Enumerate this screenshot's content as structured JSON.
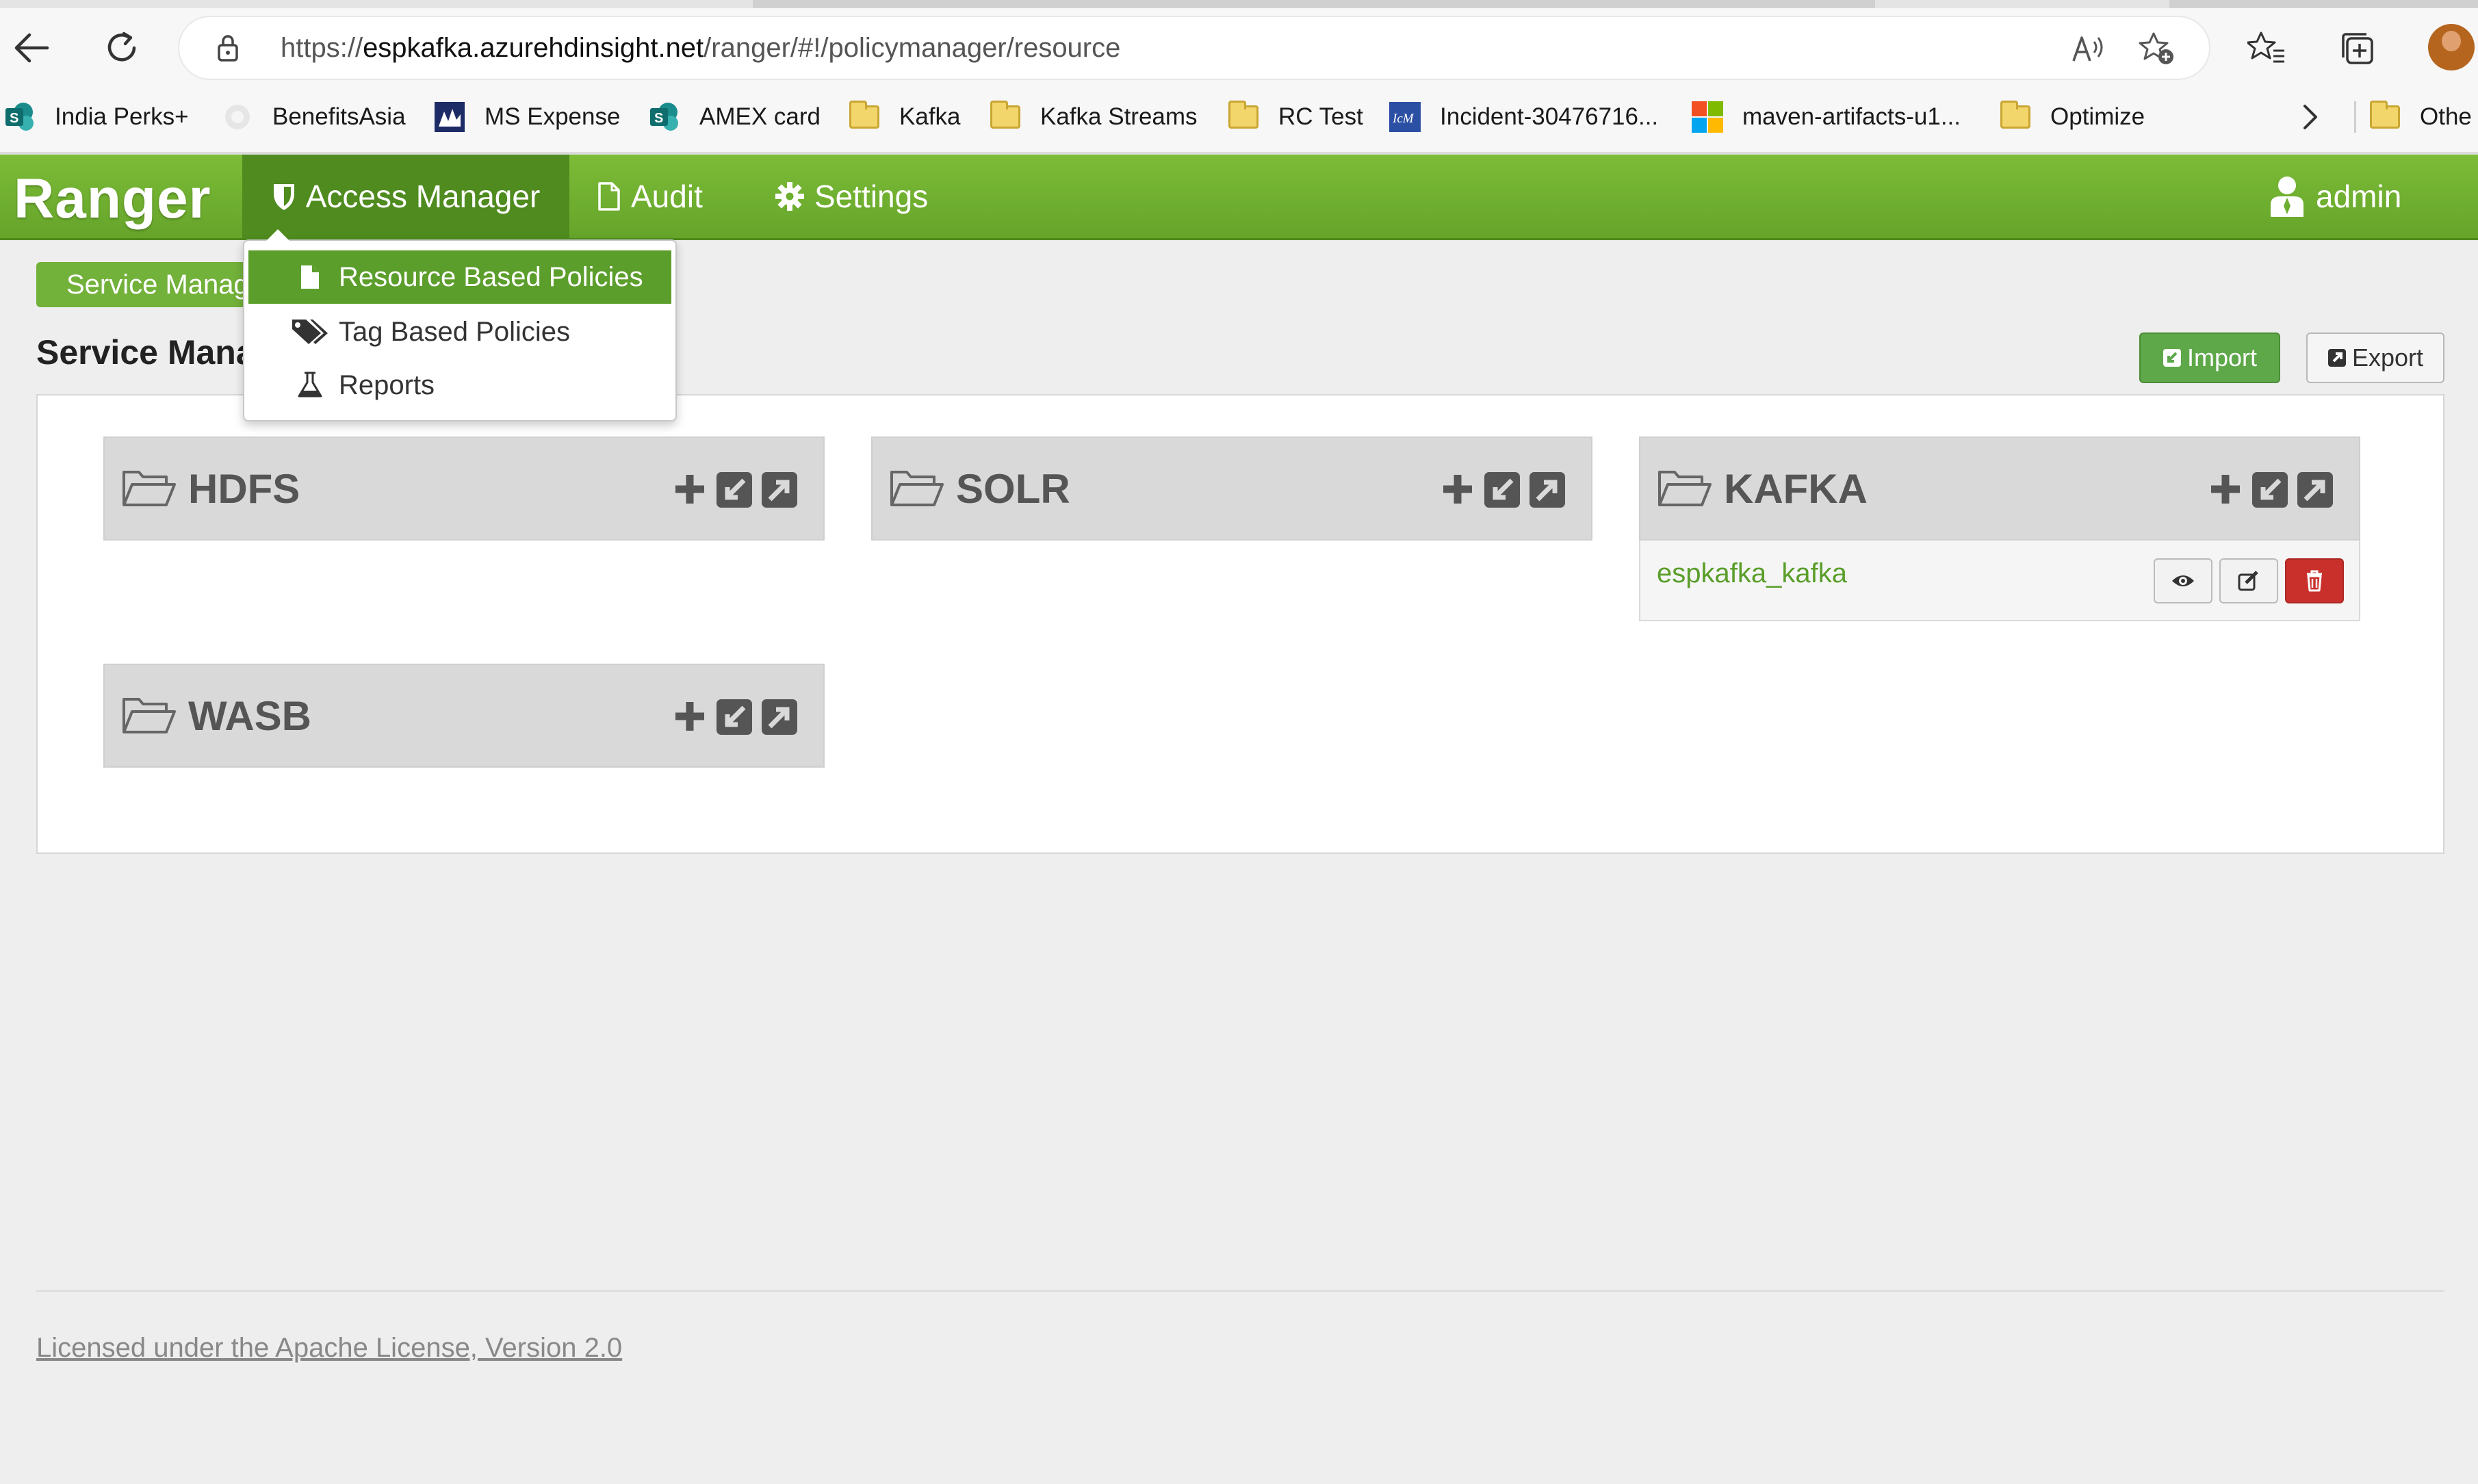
{
  "browser": {
    "url_prefix": "https://",
    "url_host": "espkafka.azurehdinsight.net",
    "url_path": "/ranger/#!/policymanager/resource",
    "bookmarks": [
      {
        "label": "India Perks+",
        "icon": "sharepoint-icon"
      },
      {
        "label": "BenefitsAsia",
        "icon": "site-icon"
      },
      {
        "label": "MS Expense",
        "icon": "expense-icon"
      },
      {
        "label": "AMEX card",
        "icon": "sharepoint-icon"
      },
      {
        "label": "Kafka",
        "icon": "folder-icon"
      },
      {
        "label": "Kafka Streams",
        "icon": "folder-icon"
      },
      {
        "label": "RC Test",
        "icon": "folder-icon"
      },
      {
        "label": "Incident-30476716...",
        "icon": "icm-icon"
      },
      {
        "label": "maven-artifacts-u1...",
        "icon": "microsoft-logo-icon"
      },
      {
        "label": "Optimize",
        "icon": "folder-icon"
      },
      {
        "label": "Othe",
        "icon": "folder-icon"
      }
    ]
  },
  "navbar": {
    "brand": "Ranger",
    "items": [
      {
        "label": "Access Manager",
        "icon": "shield-icon"
      },
      {
        "label": "Audit",
        "icon": "file-icon"
      },
      {
        "label": "Settings",
        "icon": "gear-icon"
      }
    ],
    "user": "admin"
  },
  "dropdown": {
    "items": [
      {
        "label": "Resource Based Policies",
        "icon": "file-icon"
      },
      {
        "label": "Tag Based Policies",
        "icon": "tags-icon"
      },
      {
        "label": "Reports",
        "icon": "flask-icon"
      }
    ]
  },
  "page": {
    "breadcrumb": "Service Manager",
    "title": "Service Manager",
    "import_label": "Import",
    "export_label": "Export"
  },
  "services": [
    {
      "name": "HDFS",
      "instances": []
    },
    {
      "name": "SOLR",
      "instances": []
    },
    {
      "name": "KAFKA",
      "instances": [
        "espkafka_kafka"
      ]
    },
    {
      "name": "WASB",
      "instances": []
    }
  ],
  "footer": {
    "license": "Licensed under the Apache License, Version 2.0"
  },
  "colors": {
    "navbar": "#6cae30",
    "accent_green": "#5c9e2c",
    "danger": "#c9302c"
  }
}
